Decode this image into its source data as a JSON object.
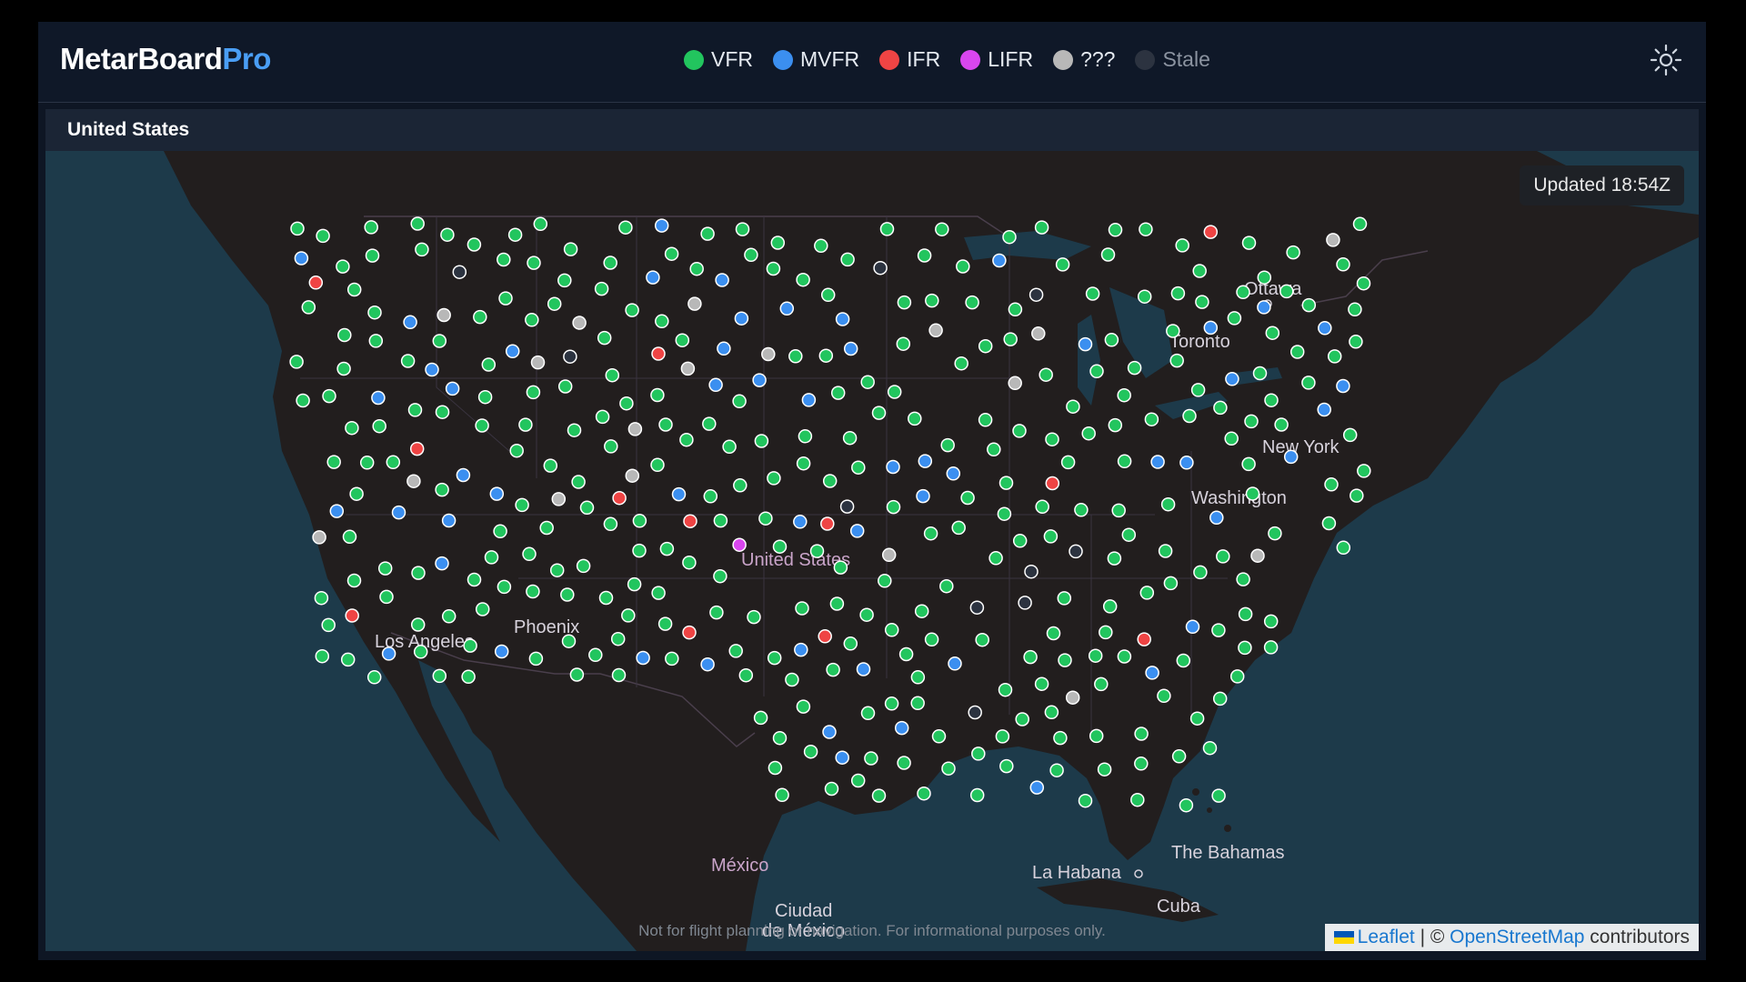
{
  "app": {
    "brand_main": "MetarBoard",
    "brand_accent": "Pro"
  },
  "legend": [
    {
      "label": "VFR",
      "color": "#22c55e"
    },
    {
      "label": "MVFR",
      "color": "#3b8ff0"
    },
    {
      "label": "IFR",
      "color": "#ef4444"
    },
    {
      "label": "LIFR",
      "color": "#d946ef"
    },
    {
      "label": "???",
      "color": "#b8b8b8"
    },
    {
      "label": "Stale",
      "color": "#2c3340"
    }
  ],
  "settings": {
    "icon": "gear-icon"
  },
  "region": {
    "title": "United States"
  },
  "map": {
    "updated": "Updated 18:54Z",
    "disclaimer": "Not for flight planning or navigation. For informational purposes only.",
    "attribution": {
      "leaflet": "Leaflet",
      "separator": " | © ",
      "osm": "OpenStreetMap",
      "suffix": " contributors"
    },
    "labels": {
      "ottawa": "Ottawa",
      "toronto": "Toronto",
      "new_york": "New York",
      "washington": "Washington",
      "united_states": "United States",
      "phoenix": "Phoenix",
      "los_angeles": "Los Angeles",
      "mexico": "México",
      "ciudad": "Ciudad",
      "de_mexico": "de México",
      "la_habana": "La Habana",
      "the_bahamas": "The Bahamas",
      "cuba": "Cuba"
    },
    "station_counts": {
      "VFR": 317,
      "MVFR": 55,
      "IFR": 12,
      "LIFR": 1,
      "???": 18,
      "Stale": 10
    }
  }
}
